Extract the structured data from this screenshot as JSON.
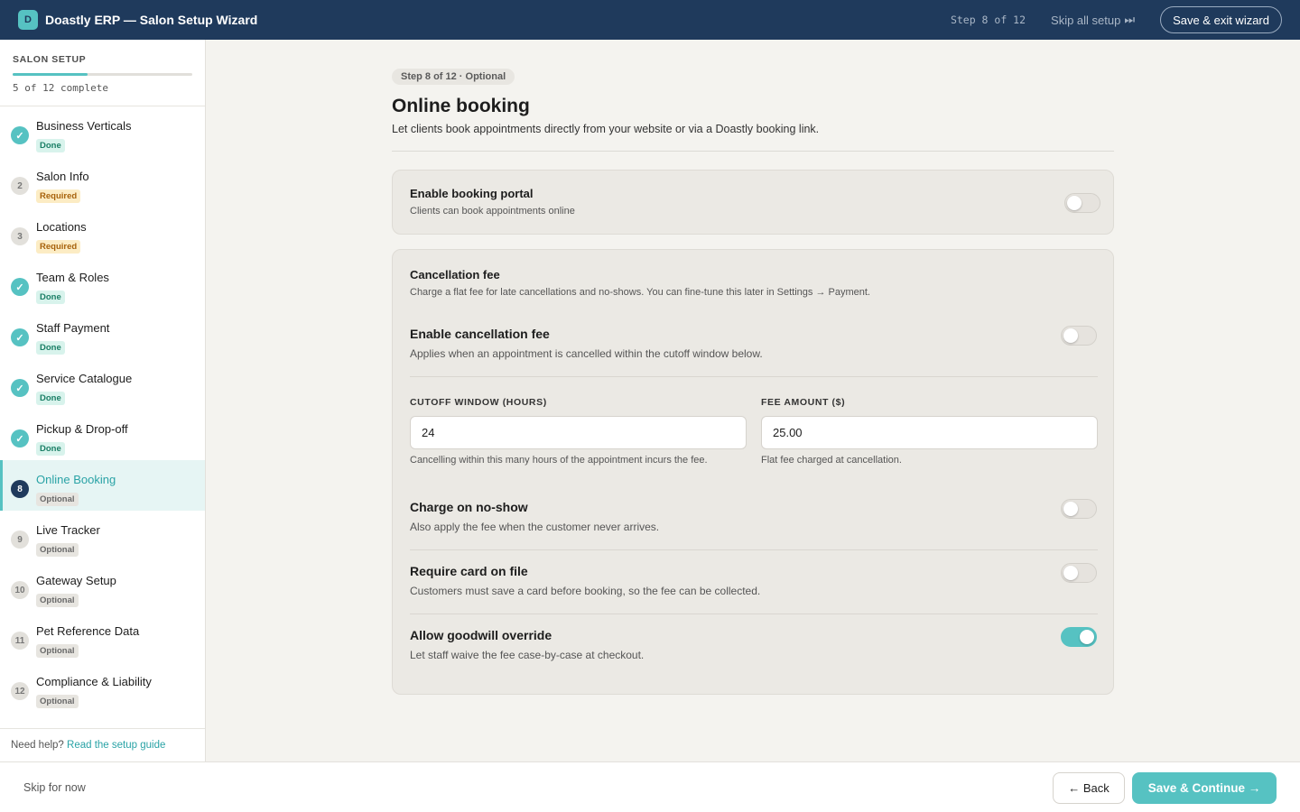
{
  "topbar": {
    "logo_letter": "D",
    "title": "Doastly ERP — Salon Setup Wizard",
    "step_counter": "Step 8 of 12",
    "skip_all": "Skip all setup",
    "skip_all_icon": "⏭",
    "save_exit": "Save & exit wizard"
  },
  "sidebar": {
    "title": "SALON SETUP",
    "progress_fraction": 0.4167,
    "progress_text": "5 of 12 complete",
    "steps": [
      {
        "label": "Business Verticals",
        "status": "Done",
        "icon": "✓"
      },
      {
        "label": "Salon Info",
        "status": "Required",
        "icon": "2"
      },
      {
        "label": "Locations",
        "status": "Required",
        "icon": "3"
      },
      {
        "label": "Team & Roles",
        "status": "Done",
        "icon": "✓"
      },
      {
        "label": "Staff Payment",
        "status": "Done",
        "icon": "✓"
      },
      {
        "label": "Service Catalogue",
        "status": "Done",
        "icon": "✓"
      },
      {
        "label": "Pickup & Drop-off",
        "status": "Done",
        "icon": "✓"
      },
      {
        "label": "Online Booking",
        "status": "Optional",
        "icon": "8"
      },
      {
        "label": "Live Tracker",
        "status": "Optional",
        "icon": "9"
      },
      {
        "label": "Gateway Setup",
        "status": "Optional",
        "icon": "10"
      },
      {
        "label": "Pet Reference Data",
        "status": "Optional",
        "icon": "11"
      },
      {
        "label": "Compliance & Liability",
        "status": "Optional",
        "icon": "12"
      }
    ],
    "help_text": "Need help?",
    "help_link": "Read the setup guide"
  },
  "main": {
    "step_pill": "Step 8 of 12 · Optional",
    "title": "Online booking",
    "subtitle": "Let clients book appointments directly from your website or via a Doastly booking link.",
    "portal": {
      "title": "Enable booking portal",
      "desc": "Clients can book appointments online",
      "enabled": false
    },
    "cancellation": {
      "title": "Cancellation fee",
      "desc": "Charge a flat fee for late cancellations and no-shows. You can fine-tune this later in Settings → Payment.",
      "enable_title": "Enable cancellation fee",
      "enable_desc": "Applies when an appointment is cancelled within the cutoff window below.",
      "enable_on": false,
      "cutoff_label": "CUTOFF WINDOW (HOURS)",
      "cutoff_value": "24",
      "cutoff_help": "Cancelling within this many hours of the appointment incurs the fee.",
      "fee_label": "FEE AMOUNT ($)",
      "fee_value": "25.00",
      "fee_help": "Flat fee charged at cancellation.",
      "noshow_title": "Charge on no-show",
      "noshow_desc": "Also apply the fee when the customer never arrives.",
      "noshow_on": false,
      "card_title": "Require card on file",
      "card_desc": "Customers must save a card before booking, so the fee can be collected.",
      "card_on": false,
      "goodwill_title": "Allow goodwill override",
      "goodwill_desc": "Let staff waive the fee case-by-case at checkout.",
      "goodwill_on": true
    }
  },
  "footer": {
    "skip": "Skip for now",
    "back": "← Back",
    "continue": "Save & Continue →"
  },
  "colors": {
    "navy": "#1f3a5c",
    "teal": "#56c2c2",
    "background": "#f4f3ef"
  }
}
